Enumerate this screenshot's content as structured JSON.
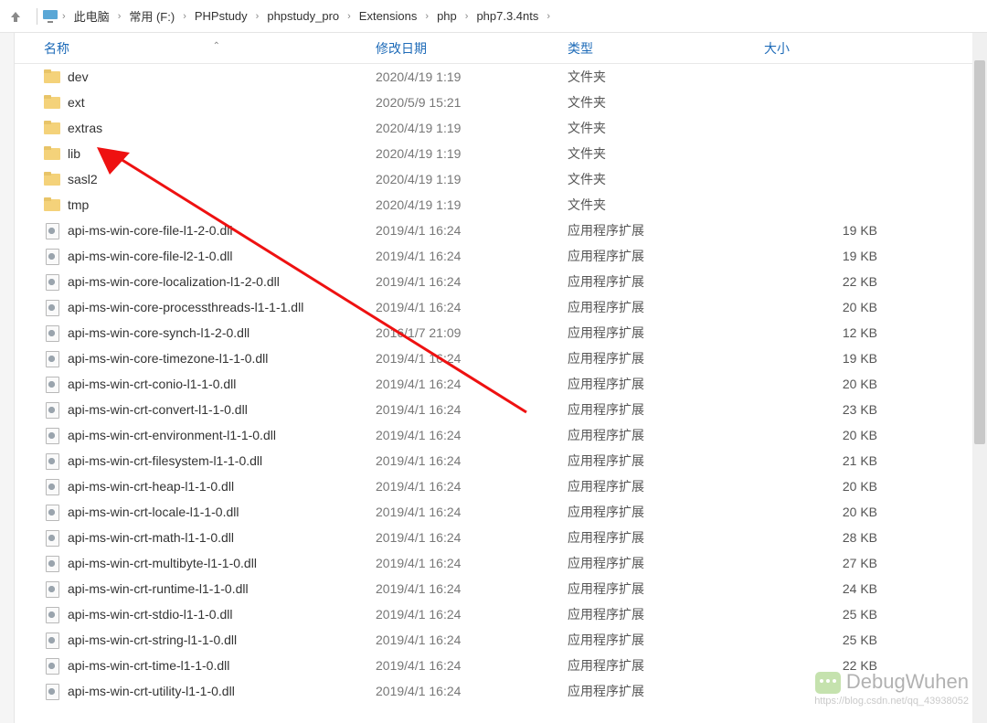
{
  "breadcrumb": {
    "items": [
      "此电脑",
      "常用 (F:)",
      "PHPstudy",
      "phpstudy_pro",
      "Extensions",
      "php",
      "php7.3.4nts"
    ]
  },
  "columns": {
    "name": "名称",
    "date": "修改日期",
    "type": "类型",
    "size": "大小"
  },
  "type_labels": {
    "folder": "文件夹",
    "dll": "应用程序扩展"
  },
  "files": [
    {
      "icon": "folder",
      "name": "dev",
      "date": "2020/4/19 1:19",
      "type": "文件夹",
      "size": ""
    },
    {
      "icon": "folder",
      "name": "ext",
      "date": "2020/5/9 15:21",
      "type": "文件夹",
      "size": ""
    },
    {
      "icon": "folder",
      "name": "extras",
      "date": "2020/4/19 1:19",
      "type": "文件夹",
      "size": ""
    },
    {
      "icon": "folder",
      "name": "lib",
      "date": "2020/4/19 1:19",
      "type": "文件夹",
      "size": ""
    },
    {
      "icon": "folder",
      "name": "sasl2",
      "date": "2020/4/19 1:19",
      "type": "文件夹",
      "size": ""
    },
    {
      "icon": "folder",
      "name": "tmp",
      "date": "2020/4/19 1:19",
      "type": "文件夹",
      "size": ""
    },
    {
      "icon": "dll",
      "name": "api-ms-win-core-file-l1-2-0.dll",
      "date": "2019/4/1 16:24",
      "type": "应用程序扩展",
      "size": "19 KB"
    },
    {
      "icon": "dll",
      "name": "api-ms-win-core-file-l2-1-0.dll",
      "date": "2019/4/1 16:24",
      "type": "应用程序扩展",
      "size": "19 KB"
    },
    {
      "icon": "dll",
      "name": "api-ms-win-core-localization-l1-2-0.dll",
      "date": "2019/4/1 16:24",
      "type": "应用程序扩展",
      "size": "22 KB"
    },
    {
      "icon": "dll",
      "name": "api-ms-win-core-processthreads-l1-1-1.dll",
      "date": "2019/4/1 16:24",
      "type": "应用程序扩展",
      "size": "20 KB"
    },
    {
      "icon": "dll",
      "name": "api-ms-win-core-synch-l1-2-0.dll",
      "date": "2016/1/7 21:09",
      "type": "应用程序扩展",
      "size": "12 KB"
    },
    {
      "icon": "dll",
      "name": "api-ms-win-core-timezone-l1-1-0.dll",
      "date": "2019/4/1 16:24",
      "type": "应用程序扩展",
      "size": "19 KB"
    },
    {
      "icon": "dll",
      "name": "api-ms-win-crt-conio-l1-1-0.dll",
      "date": "2019/4/1 16:24",
      "type": "应用程序扩展",
      "size": "20 KB"
    },
    {
      "icon": "dll",
      "name": "api-ms-win-crt-convert-l1-1-0.dll",
      "date": "2019/4/1 16:24",
      "type": "应用程序扩展",
      "size": "23 KB"
    },
    {
      "icon": "dll",
      "name": "api-ms-win-crt-environment-l1-1-0.dll",
      "date": "2019/4/1 16:24",
      "type": "应用程序扩展",
      "size": "20 KB"
    },
    {
      "icon": "dll",
      "name": "api-ms-win-crt-filesystem-l1-1-0.dll",
      "date": "2019/4/1 16:24",
      "type": "应用程序扩展",
      "size": "21 KB"
    },
    {
      "icon": "dll",
      "name": "api-ms-win-crt-heap-l1-1-0.dll",
      "date": "2019/4/1 16:24",
      "type": "应用程序扩展",
      "size": "20 KB"
    },
    {
      "icon": "dll",
      "name": "api-ms-win-crt-locale-l1-1-0.dll",
      "date": "2019/4/1 16:24",
      "type": "应用程序扩展",
      "size": "20 KB"
    },
    {
      "icon": "dll",
      "name": "api-ms-win-crt-math-l1-1-0.dll",
      "date": "2019/4/1 16:24",
      "type": "应用程序扩展",
      "size": "28 KB"
    },
    {
      "icon": "dll",
      "name": "api-ms-win-crt-multibyte-l1-1-0.dll",
      "date": "2019/4/1 16:24",
      "type": "应用程序扩展",
      "size": "27 KB"
    },
    {
      "icon": "dll",
      "name": "api-ms-win-crt-runtime-l1-1-0.dll",
      "date": "2019/4/1 16:24",
      "type": "应用程序扩展",
      "size": "24 KB"
    },
    {
      "icon": "dll",
      "name": "api-ms-win-crt-stdio-l1-1-0.dll",
      "date": "2019/4/1 16:24",
      "type": "应用程序扩展",
      "size": "25 KB"
    },
    {
      "icon": "dll",
      "name": "api-ms-win-crt-string-l1-1-0.dll",
      "date": "2019/4/1 16:24",
      "type": "应用程序扩展",
      "size": "25 KB"
    },
    {
      "icon": "dll",
      "name": "api-ms-win-crt-time-l1-1-0.dll",
      "date": "2019/4/1 16:24",
      "type": "应用程序扩展",
      "size": "22 KB"
    },
    {
      "icon": "dll",
      "name": "api-ms-win-crt-utility-l1-1-0.dll",
      "date": "2019/4/1 16:24",
      "type": "应用程序扩展",
      "size": ""
    }
  ],
  "watermark": {
    "text": "DebugWuhen",
    "sub": "https://blog.csdn.net/qq_43938052"
  }
}
